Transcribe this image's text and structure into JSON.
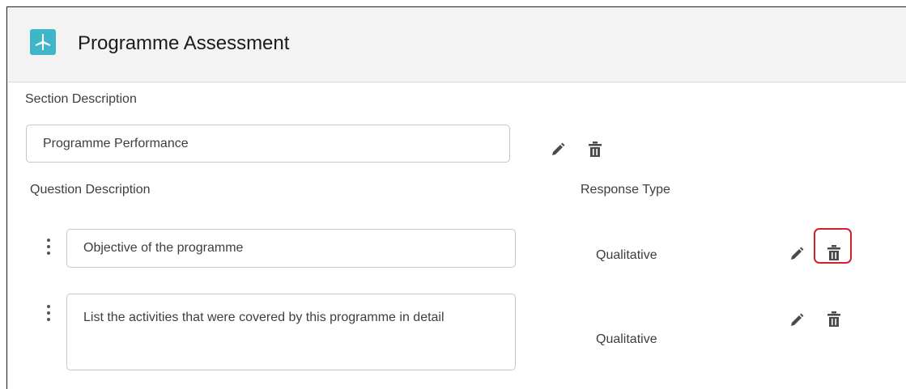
{
  "header": {
    "title": "Programme Assessment",
    "icon": "app-icon",
    "icon_color": "#3fb6c8"
  },
  "section": {
    "label": "Section Description",
    "value": "Programme Performance",
    "icons": [
      "pencil-icon",
      "trash-icon"
    ]
  },
  "columns": {
    "question": "Question Description",
    "response": "Response Type"
  },
  "questions": [
    {
      "text": "Objective of the programme",
      "response_type": "Qualitative",
      "icons": [
        "drag-handle-icon",
        "pencil-icon",
        "trash-icon"
      ]
    },
    {
      "text": "List the activities that were covered by this programme in detail",
      "response_type": "Qualitative",
      "icons": [
        "drag-handle-icon",
        "pencil-icon",
        "trash-icon"
      ]
    }
  ],
  "annotation_color": "#d0202c"
}
